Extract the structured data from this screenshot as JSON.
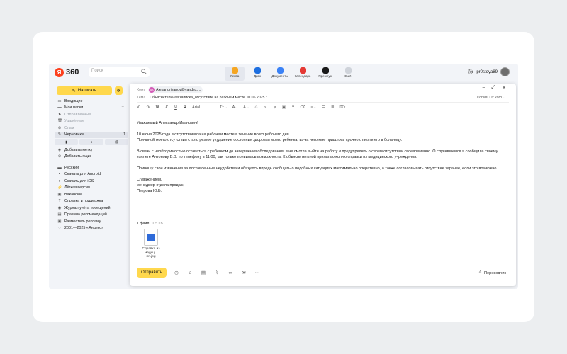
{
  "header": {
    "logo_mark": "Я",
    "logo_text": "360",
    "search_placeholder": "Поиск",
    "services": [
      {
        "label": "Лента",
        "color": "#f5a623",
        "active": true
      },
      {
        "label": "Диск",
        "color": "#1e6fe0",
        "active": false
      },
      {
        "label": "Документы",
        "color": "#3b82f6",
        "active": false
      },
      {
        "label": "Календарь",
        "color": "#e53935",
        "active": false
      },
      {
        "label": "Премиум",
        "color": "#1a1a1a",
        "active": false
      },
      {
        "label": "Ещё",
        "color": "#cfd3da",
        "active": false
      }
    ],
    "username": "pr0stoya89"
  },
  "sidebar": {
    "compose_label": "Написать",
    "folders": [
      {
        "icon": "inbox-icon",
        "glyph": "▭",
        "label": "Входящие",
        "muted": false
      },
      {
        "icon": "folder-icon",
        "glyph": "▬",
        "label": "Мои папки",
        "muted": false,
        "plus": "+"
      },
      {
        "icon": "sent-icon",
        "glyph": "➤",
        "label": "Отправленные",
        "muted": true
      },
      {
        "icon": "trash-icon",
        "glyph": "🗑",
        "label": "Удалённые",
        "muted": true
      },
      {
        "icon": "spam-icon",
        "glyph": "⊘",
        "label": "Спам",
        "muted": true
      },
      {
        "icon": "drafts-icon",
        "glyph": "✎",
        "label": "Черновики",
        "muted": false,
        "count": "1",
        "selected": true
      }
    ],
    "label_buttons": [
      "▮",
      "●",
      "@"
    ],
    "actions": [
      {
        "icon": "tag-icon",
        "glyph": "◈",
        "label": "Добавить метку"
      },
      {
        "icon": "add-mailbox-icon",
        "glyph": "⊕",
        "label": "Добавить ящик"
      }
    ],
    "links": [
      {
        "icon": "flag-icon",
        "glyph": "▬",
        "label": "Русский"
      },
      {
        "icon": "android-icon",
        "glyph": "▪",
        "label": "Скачать для Android"
      },
      {
        "icon": "apple-icon",
        "glyph": "●",
        "label": "Скачать для iOS"
      },
      {
        "icon": "light-version-icon",
        "glyph": "⚡",
        "label": "Лёгкая версия"
      },
      {
        "icon": "jobs-icon",
        "glyph": "▣",
        "label": "Вакансии"
      },
      {
        "icon": "help-icon",
        "glyph": "?",
        "label": "Справка и поддержка"
      },
      {
        "icon": "log-icon",
        "glyph": "◉",
        "label": "Журнал учёта посещений"
      },
      {
        "icon": "recommend-icon",
        "glyph": "▤",
        "label": "Правила рекомендаций"
      },
      {
        "icon": "ads-icon",
        "glyph": "▣",
        "label": "Разместить рекламу"
      },
      {
        "icon": "copyright-icon",
        "glyph": "◌",
        "label": "2001—2025 «Яндекс»"
      }
    ]
  },
  "compose": {
    "to_label": "Кому",
    "recipient_initials": "AA",
    "recipient": "Alexandrivanov@yandex....",
    "subject_label": "Тема",
    "subject": "Объяснительная записка_отсутствие на рабочем месте 10.06.2025 г",
    "cc_label": "Копия, От кого",
    "font_name": "Arial",
    "body": {
      "greeting": "Уважаемый Александр Иванович!",
      "p1_line1": "10 июня 2025 года я отсутствовала на рабочем месте в течение всего рабочего дня.",
      "p1_line2": "Причиной моего отсутствия стало резкое ухудшение состояния здоровья моего ребенка, из-за чего мне пришлось срочно отвезти его в больницу.",
      "p2": "В связи с необходимостью оставаться с ребенком до завершения обследования, я не смогла выйти на работу и предупредить о своем отсутствии своевременно. О случившемся я сообщила своему коллеге Антонову В.В. по телефону в 11:00, как только появилась возможность. К объяснительной прилагаю копию справки из медицинского учреждения.",
      "p3": "Приношу свои извинения за доставленные неудобства и обязуюсь впредь сообщать о подобных ситуациях максимально оперативно, а также согласовывать отсутствие заранее, если это возможно.",
      "sign1": "С уважением,",
      "sign2": "менеджер отдела продаж,",
      "sign3": "Петрова Ю.Б."
    },
    "attachments_count": "1 файл",
    "attachments_size": "105 КБ",
    "attachment_name": "Справка из медиц... ия.jpg",
    "send_label": "Отправить",
    "translator_label": "Переводчик"
  },
  "colors": {
    "accent": "#ffd84d",
    "brand": "#fc3f1d",
    "background": "#eceef0"
  }
}
